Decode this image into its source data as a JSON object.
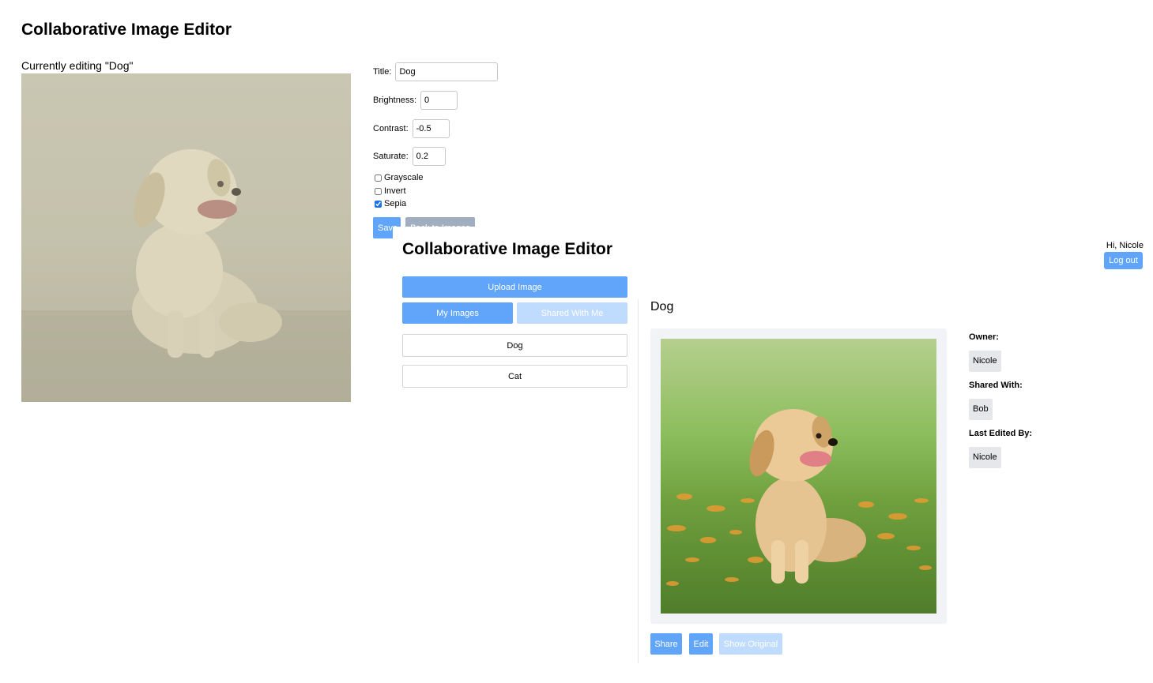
{
  "editor_window": {
    "app_title": "Collaborative Image Editor",
    "editing_caption": "Currently editing \"Dog\"",
    "image_alt": "Dog",
    "form": {
      "title_label": "Title:",
      "title_value": "Dog",
      "brightness_label": "Brightness:",
      "brightness_value": "0",
      "contrast_label": "Contrast:",
      "contrast_value": "-0.5",
      "saturate_label": "Saturate:",
      "saturate_value": "0.2",
      "grayscale_label": "Grayscale",
      "grayscale_checked": false,
      "invert_label": "Invert",
      "invert_checked": false,
      "sepia_label": "Sepia",
      "sepia_checked": true
    },
    "save_label": "Save",
    "back_label": "Back to Images"
  },
  "gallery_window": {
    "app_title": "Collaborative Image Editor",
    "greeting": "Hi, Nicole",
    "logout_label": "Log out",
    "upload_label": "Upload Image",
    "tabs": {
      "my_images": "My Images",
      "shared_with_me": "Shared With Me"
    },
    "images": [
      {
        "label": "Dog"
      },
      {
        "label": "Cat"
      }
    ],
    "detail": {
      "title": "Dog",
      "owner_label": "Owner:",
      "owner": "Nicole",
      "shared_with_label": "Shared With:",
      "shared_with": "Bob",
      "last_edited_label": "Last Edited By:",
      "last_edited_by": "Nicole"
    },
    "actions": {
      "share": "Share",
      "edit": "Edit",
      "show_original": "Show Original"
    }
  },
  "colors": {
    "primary": "#60a5fa",
    "primary_disabled": "#bfdbfe",
    "secondary": "#a0aec0",
    "chip_bg": "#e5e7eb",
    "card_bg": "#f1f3f6"
  }
}
